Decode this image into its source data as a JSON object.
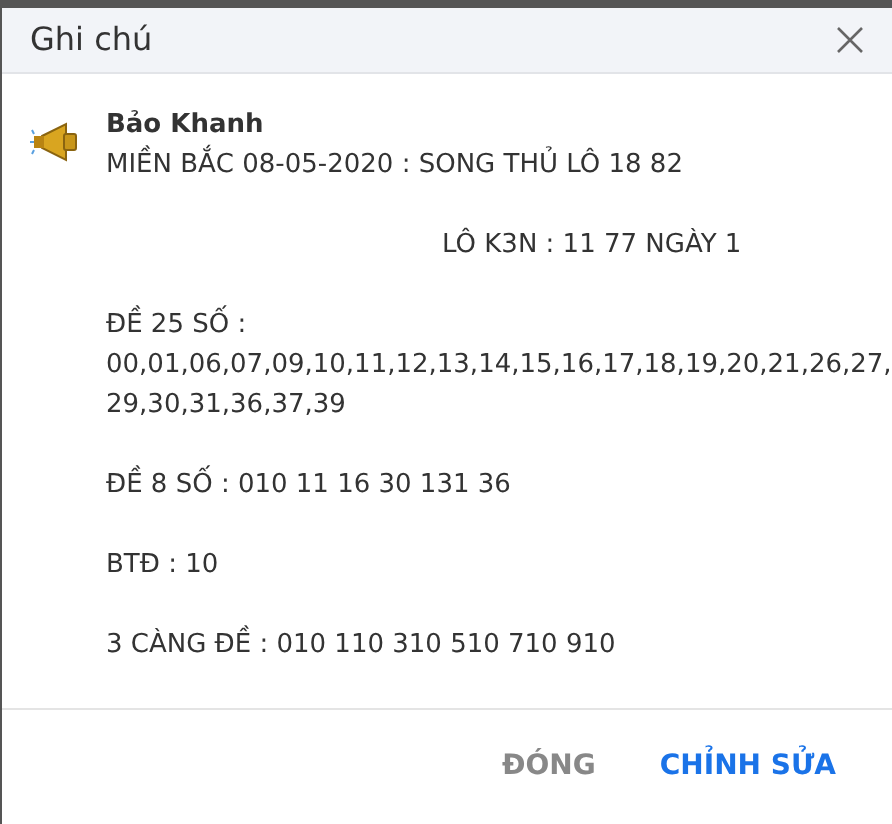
{
  "dialog": {
    "title": "Ghi chú",
    "author": "Bảo Khanh",
    "lines": [
      {
        "kind": "text",
        "text": "MIỀN BẮC 08-05-2020 : SONG THỦ LÔ 18 82"
      },
      {
        "kind": "blank"
      },
      {
        "kind": "indented",
        "text": "LÔ K3N : 11 77 NGÀY 1"
      },
      {
        "kind": "blank"
      },
      {
        "kind": "text",
        "text": "ĐỀ 25 SỐ :"
      },
      {
        "kind": "text",
        "text": "00,01,06,07,09,10,11,12,13,14,15,16,17,18,19,20,21,26,27,"
      },
      {
        "kind": "text",
        "text": "29,30,31,36,37,39"
      },
      {
        "kind": "blank"
      },
      {
        "kind": "text",
        "text": "ĐỀ 8 SỐ : 010 11 16 30 131 36"
      },
      {
        "kind": "blank"
      },
      {
        "kind": "text",
        "text": "BTĐ : 10"
      },
      {
        "kind": "blank"
      },
      {
        "kind": "text",
        "text": "3 CÀNG ĐỀ : 010 110 310 510 710 910"
      }
    ],
    "buttons": [
      {
        "label": "ĐÓNG",
        "kind": "secondary"
      },
      {
        "label": "CHỈNH SỬA",
        "kind": "primary"
      }
    ]
  }
}
